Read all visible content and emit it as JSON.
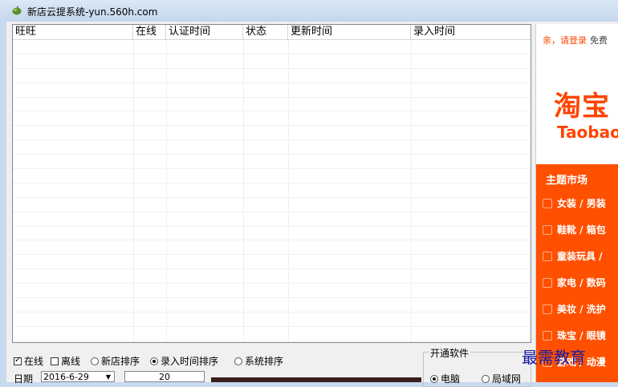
{
  "window": {
    "title": "新店云提系统-yun.560h.com"
  },
  "list": {
    "columns": [
      "旺旺",
      "在线",
      "认证时间",
      "状态",
      "更新时间",
      "录入时间"
    ]
  },
  "filters": {
    "online": {
      "label": "在线",
      "checked": true
    },
    "offline": {
      "label": "离线",
      "checked": false
    },
    "sort_new_store": {
      "label": "新店排序",
      "checked": false
    },
    "sort_entry_time": {
      "label": "录入时间排序",
      "checked": true
    },
    "sort_system": {
      "label": "系统排序",
      "checked": false
    }
  },
  "date": {
    "label": "日期",
    "value": "2016-6-29"
  },
  "count": {
    "value": "20"
  },
  "open_software": {
    "title": "开通软件",
    "options": [
      {
        "label": "电脑",
        "checked": true
      },
      {
        "label": "局域网",
        "checked": false
      }
    ]
  },
  "taobao": {
    "login_link": "亲，请登录",
    "free_text": "免费",
    "logo_cn": "淘宝",
    "logo_en": "Taobao",
    "market_title": "主题市场",
    "market_items": [
      "女装 / 男装",
      "鞋靴 / 箱包",
      "童装玩具 /",
      "家电 / 数码",
      "美妆 / 洗护",
      "珠宝 / 眼镜",
      "游戏 / 动漫"
    ]
  },
  "watermark": "最需教育",
  "colors": {
    "taobao_orange": "#ff5000",
    "title_bar": "#c4d6ed"
  }
}
